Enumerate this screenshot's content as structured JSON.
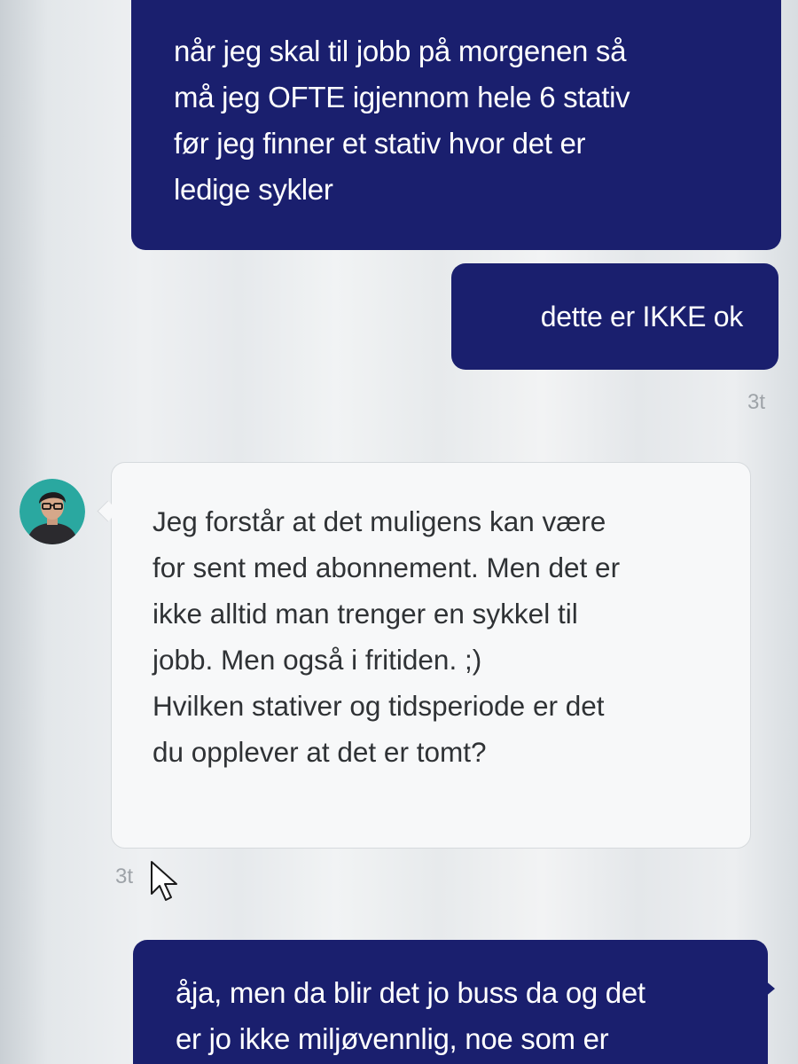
{
  "conversation": {
    "messages": [
      {
        "direction": "outgoing",
        "lines": [
          "når jeg skal til jobb på morgenen så",
          "må jeg OFTE igjennom hele 6 stativ",
          "før jeg finner et stativ hvor det er",
          "ledige sykler"
        ]
      },
      {
        "direction": "outgoing",
        "lines": [
          "dette er IKKE ok"
        ],
        "timestamp": "3t"
      },
      {
        "direction": "incoming",
        "lines": [
          "Jeg forstår at det muligens kan være",
          "for sent med abonnement. Men det er",
          "ikke alltid man trenger en sykkel til",
          "jobb. Men også i fritiden. ;)",
          "Hvilken stativer og tidsperiode er det",
          "du opplever at det er tomt?"
        ],
        "timestamp": "3t"
      },
      {
        "direction": "outgoing",
        "lines": [
          "åja, men da blir det jo buss da og det",
          "er jo ikke miljøvennlig, noe som er"
        ]
      }
    ]
  },
  "colors": {
    "outgoing_bubble": "#1a1f6e",
    "incoming_bubble": "#f7f8f9",
    "timestamp": "#9ea3a8"
  },
  "icons": {
    "agent_avatar": "agent-avatar-icon",
    "cursor": "mouse-pointer-icon"
  }
}
